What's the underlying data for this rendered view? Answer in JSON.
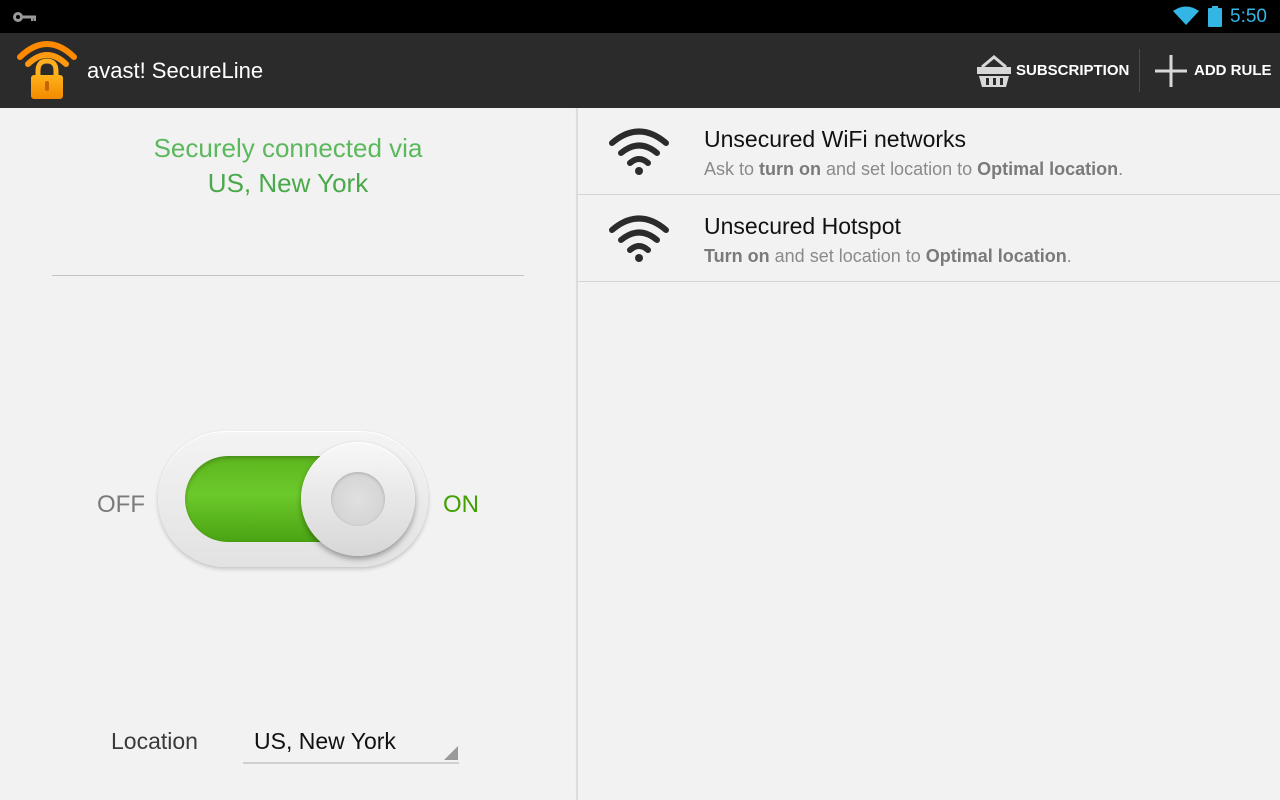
{
  "status_bar": {
    "time": "5:50",
    "icons": [
      "key-icon",
      "wifi-status-icon",
      "battery-icon"
    ]
  },
  "action_bar": {
    "title": "avast! SecureLine",
    "subscription_label": "SUBSCRIPTION",
    "add_rule_label": "ADD RULE"
  },
  "connection": {
    "status_text": "Securely connected via",
    "location": "US, New York"
  },
  "toggle": {
    "off_label": "OFF",
    "on_label": "ON",
    "state": "on"
  },
  "location_selector": {
    "label": "Location",
    "value": "US, New York"
  },
  "rules": [
    {
      "title": "Unsecured WiFi networks",
      "desc_1": "Ask to ",
      "desc_bold_1": "turn on",
      "desc_2": " and set location to ",
      "desc_bold_2": "Optimal location",
      "desc_3": "."
    },
    {
      "title": "Unsecured Hotspot",
      "desc_1": "",
      "desc_bold_1": "Turn on",
      "desc_2": " and set location to ",
      "desc_bold_2": "Optimal location",
      "desc_3": "."
    }
  ],
  "colors": {
    "accent_green": "#4caf50",
    "status_blue": "#33b5e5",
    "action_bar": "#2b2b2b"
  }
}
